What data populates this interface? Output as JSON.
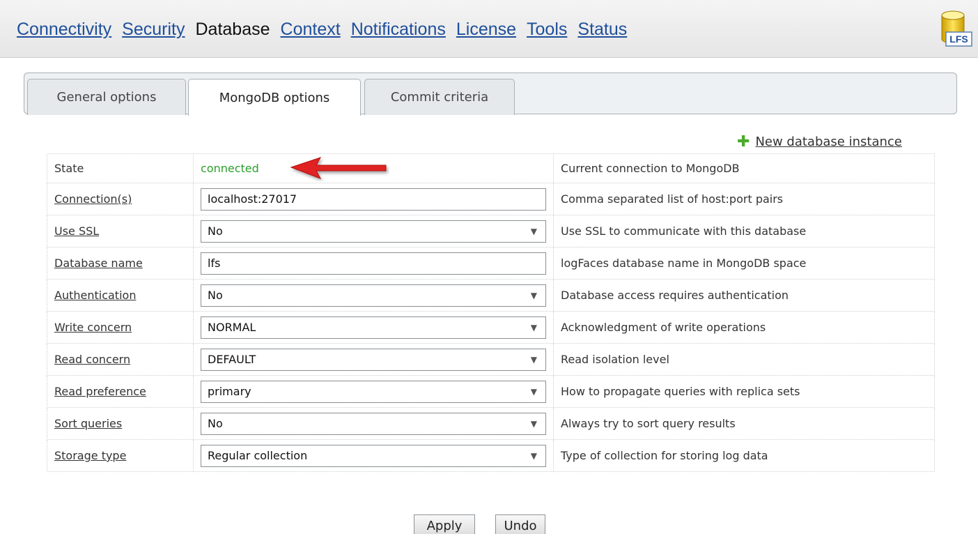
{
  "nav": {
    "items": [
      {
        "label": "Connectivity",
        "active": false
      },
      {
        "label": "Security",
        "active": false
      },
      {
        "label": "Database",
        "active": true
      },
      {
        "label": "Context",
        "active": false
      },
      {
        "label": "Notifications",
        "active": false
      },
      {
        "label": "License",
        "active": false
      },
      {
        "label": "Tools",
        "active": false
      },
      {
        "label": "Status",
        "active": false
      }
    ]
  },
  "logo": {
    "text": "LFS",
    "icon": "database-icon"
  },
  "tabs": [
    {
      "label": "General options",
      "active": false
    },
    {
      "label": "MongoDB options",
      "active": true
    },
    {
      "label": "Commit criteria",
      "active": false
    }
  ],
  "new_instance": {
    "label": "New database instance",
    "icon": "plus-icon"
  },
  "state": {
    "label": "State",
    "value": "connected",
    "description": "Current connection to MongoDB"
  },
  "options": [
    {
      "label": "Connection(s)",
      "type": "text",
      "value": "localhost:27017",
      "description": "Comma separated list of host:port pairs"
    },
    {
      "label": "Use SSL",
      "type": "select",
      "value": "No",
      "description": "Use SSL to communicate with this database"
    },
    {
      "label": "Database name",
      "type": "text",
      "value": "lfs",
      "description": "logFaces database name in MongoDB space"
    },
    {
      "label": "Authentication",
      "type": "select",
      "value": "No",
      "description": "Database access requires authentication"
    },
    {
      "label": "Write concern",
      "type": "select",
      "value": "NORMAL",
      "description": "Acknowledgment of write operations"
    },
    {
      "label": "Read concern",
      "type": "select",
      "value": "DEFAULT",
      "description": "Read isolation level"
    },
    {
      "label": "Read preference",
      "type": "select",
      "value": "primary",
      "description": "How to propagate queries with replica sets"
    },
    {
      "label": "Sort queries",
      "type": "select",
      "value": "No",
      "description": "Always try to sort query results"
    },
    {
      "label": "Storage type",
      "type": "select",
      "value": "Regular collection",
      "description": "Type of collection for storing log data"
    }
  ],
  "buttons": {
    "apply": "Apply",
    "undo": "Undo"
  },
  "colors": {
    "link": "#1e4f9b",
    "connected": "#2aa02a",
    "arrow": "#e02020",
    "plus": "#4caa2e"
  }
}
